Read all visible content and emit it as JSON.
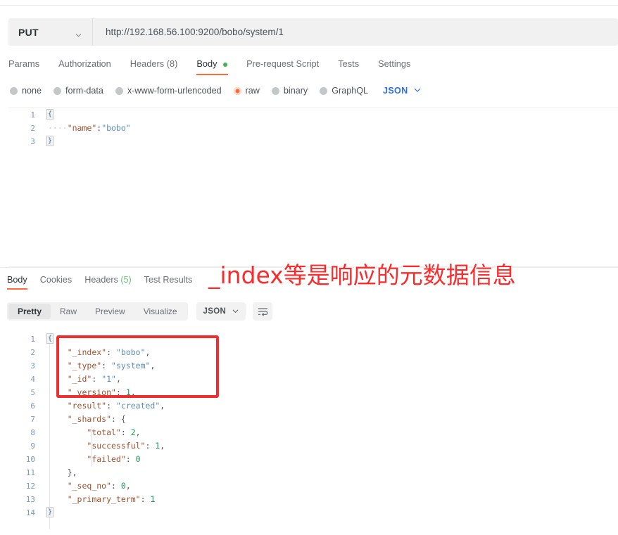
{
  "request": {
    "method": "PUT",
    "method_caret_icon": "chevron-down-icon",
    "url": "http://192.168.56.100:9200/bobo/system/1",
    "tabs": [
      {
        "label": "Params",
        "active": false,
        "dot": false
      },
      {
        "label": "Authorization",
        "active": false,
        "dot": false
      },
      {
        "label": "Headers (8)",
        "active": false,
        "dot": false
      },
      {
        "label": "Body",
        "active": true,
        "dot": true
      },
      {
        "label": "Pre-request Script",
        "active": false,
        "dot": false
      },
      {
        "label": "Tests",
        "active": false,
        "dot": false
      },
      {
        "label": "Settings",
        "active": false,
        "dot": false
      }
    ],
    "body_types": [
      {
        "label": "none",
        "selected": false
      },
      {
        "label": "form-data",
        "selected": false
      },
      {
        "label": "x-www-form-urlencoded",
        "selected": false
      },
      {
        "label": "raw",
        "selected": true
      },
      {
        "label": "binary",
        "selected": false
      },
      {
        "label": "GraphQL",
        "selected": false
      }
    ],
    "format_label": "JSON",
    "format_caret_icon": "chevron-down-icon",
    "body_lines": [
      {
        "num": "1",
        "fold": "{",
        "text": ""
      },
      {
        "num": "2",
        "fold": "",
        "text": "    \"name\":\"bobo\""
      },
      {
        "num": "3",
        "fold": "}",
        "text": ""
      }
    ]
  },
  "response": {
    "tabs": [
      {
        "label": "Body",
        "count": "",
        "active": true
      },
      {
        "label": "Cookies",
        "count": "",
        "active": false
      },
      {
        "label": "Headers",
        "count": "(5)",
        "active": false
      },
      {
        "label": "Test Results",
        "count": "",
        "active": false
      }
    ],
    "view_modes": [
      {
        "label": "Pretty",
        "active": true
      },
      {
        "label": "Raw",
        "active": false
      },
      {
        "label": "Preview",
        "active": false
      },
      {
        "label": "Visualize",
        "active": false
      }
    ],
    "format_label": "JSON",
    "format_caret_icon": "chevron-down-icon",
    "wrap_icon": "word-wrap-icon",
    "body_lines": [
      {
        "num": "1",
        "fold": "{",
        "text": ""
      },
      {
        "num": "2",
        "fold": "",
        "text": "    \"_index\": \"bobo\","
      },
      {
        "num": "3",
        "fold": "",
        "text": "    \"_type\": \"system\","
      },
      {
        "num": "4",
        "fold": "",
        "text": "    \"_id\": \"1\","
      },
      {
        "num": "5",
        "fold": "",
        "text": "    \"_version\": 1,"
      },
      {
        "num": "6",
        "fold": "",
        "text": "    \"result\": \"created\","
      },
      {
        "num": "7",
        "fold": "",
        "text": "    \"_shards\": {"
      },
      {
        "num": "8",
        "fold": "",
        "text": "        \"total\": 2,"
      },
      {
        "num": "9",
        "fold": "",
        "text": "        \"successful\": 1,"
      },
      {
        "num": "10",
        "fold": "",
        "text": "        \"failed\": 0"
      },
      {
        "num": "11",
        "fold": "",
        "text": "    },"
      },
      {
        "num": "12",
        "fold": "",
        "text": "    \"_seq_no\": 0,"
      },
      {
        "num": "13",
        "fold": "",
        "text": "    \"_primary_term\": 1"
      },
      {
        "num": "14",
        "fold": "}",
        "text": ""
      }
    ]
  },
  "annotations": {
    "note_text": "_index等是响应的元数据信息",
    "note_color": "#fb2b2b",
    "highlight_box_color": "#ef2f2f"
  }
}
